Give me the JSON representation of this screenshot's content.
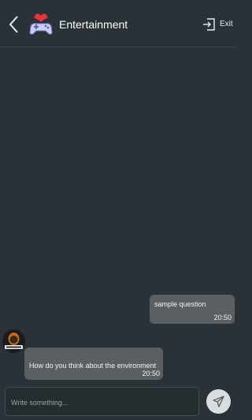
{
  "header": {
    "title": "Entertainment",
    "exit_label": "Exit",
    "back_icon": "chevron-left-icon",
    "logo_icon": "heart-gamepad-logo",
    "exit_icon": "exit-icon"
  },
  "messages": [
    {
      "direction": "outgoing",
      "text": "sample question",
      "time": "20:50"
    },
    {
      "direction": "incoming",
      "text": "How do you think about the environment",
      "time": "20:50"
    }
  ],
  "composer": {
    "placeholder": "Write something...",
    "send_icon": "send-icon"
  },
  "colors": {
    "background": "#2a3237",
    "bubble": "#5b5f62",
    "send_button": "#d9dde0"
  }
}
